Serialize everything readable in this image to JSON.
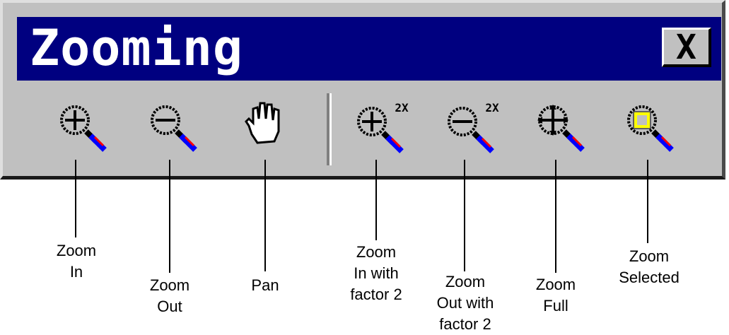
{
  "window": {
    "title": "Zooming",
    "close_glyph": "X",
    "colors": {
      "titlebar": "#000080",
      "face": "#c0c0c0",
      "lens_marker": "#ffff00"
    }
  },
  "toolbar": {
    "buttons": [
      {
        "icon": "zoom-in-icon"
      },
      {
        "icon": "zoom-out-icon"
      },
      {
        "icon": "pan-hand-icon"
      },
      {
        "icon": "zoom-in-2x-icon",
        "badge": "2X"
      },
      {
        "icon": "zoom-out-2x-icon",
        "badge": "2X"
      },
      {
        "icon": "zoom-full-icon"
      },
      {
        "icon": "zoom-selected-icon"
      }
    ]
  },
  "callouts": [
    {
      "lines": [
        "Zoom",
        "In"
      ]
    },
    {
      "lines": [
        "Zoom",
        "Out"
      ]
    },
    {
      "lines": [
        "Pan"
      ]
    },
    {
      "lines": [
        "Zoom",
        "In with",
        "factor 2"
      ]
    },
    {
      "lines": [
        "Zoom",
        "Out with",
        "factor 2"
      ]
    },
    {
      "lines": [
        "Zoom",
        "Full"
      ]
    },
    {
      "lines": [
        "Zoom",
        "Selected"
      ]
    }
  ]
}
